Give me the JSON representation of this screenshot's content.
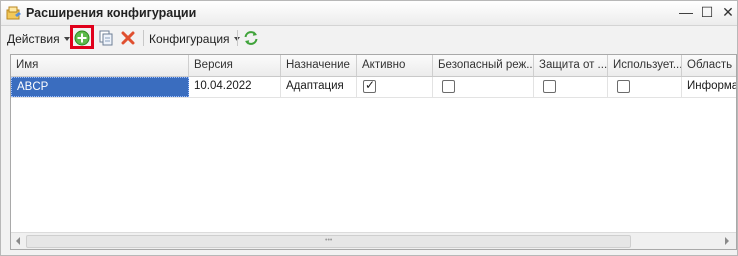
{
  "window": {
    "title": "Расширения конфигурации"
  },
  "toolbar": {
    "actions_label": "Действия",
    "configuration_label": "Конфигурация"
  },
  "icons": {
    "app": "extensions-config-icon",
    "add": "add-green-plus-icon",
    "copy": "copy-icon",
    "delete": "delete-x-icon",
    "refresh": "refresh-icon",
    "minimize": "minimize-icon",
    "maximize": "maximize-icon",
    "close": "close-icon"
  },
  "colors": {
    "highlight": "#e0001b",
    "selection": "#3a6dbf"
  },
  "grid": {
    "columns": [
      "Имя",
      "Версия",
      "Назначение",
      "Активно",
      "Безопасный реж...",
      "Защита от ...",
      "Использует...",
      "Область ..."
    ],
    "rows": [
      {
        "name": "ABCP",
        "version": "10.04.2022",
        "purpose": "Адаптация",
        "active": true,
        "safe_mode": false,
        "protection": false,
        "uses": false,
        "scope": "Информа"
      }
    ]
  }
}
